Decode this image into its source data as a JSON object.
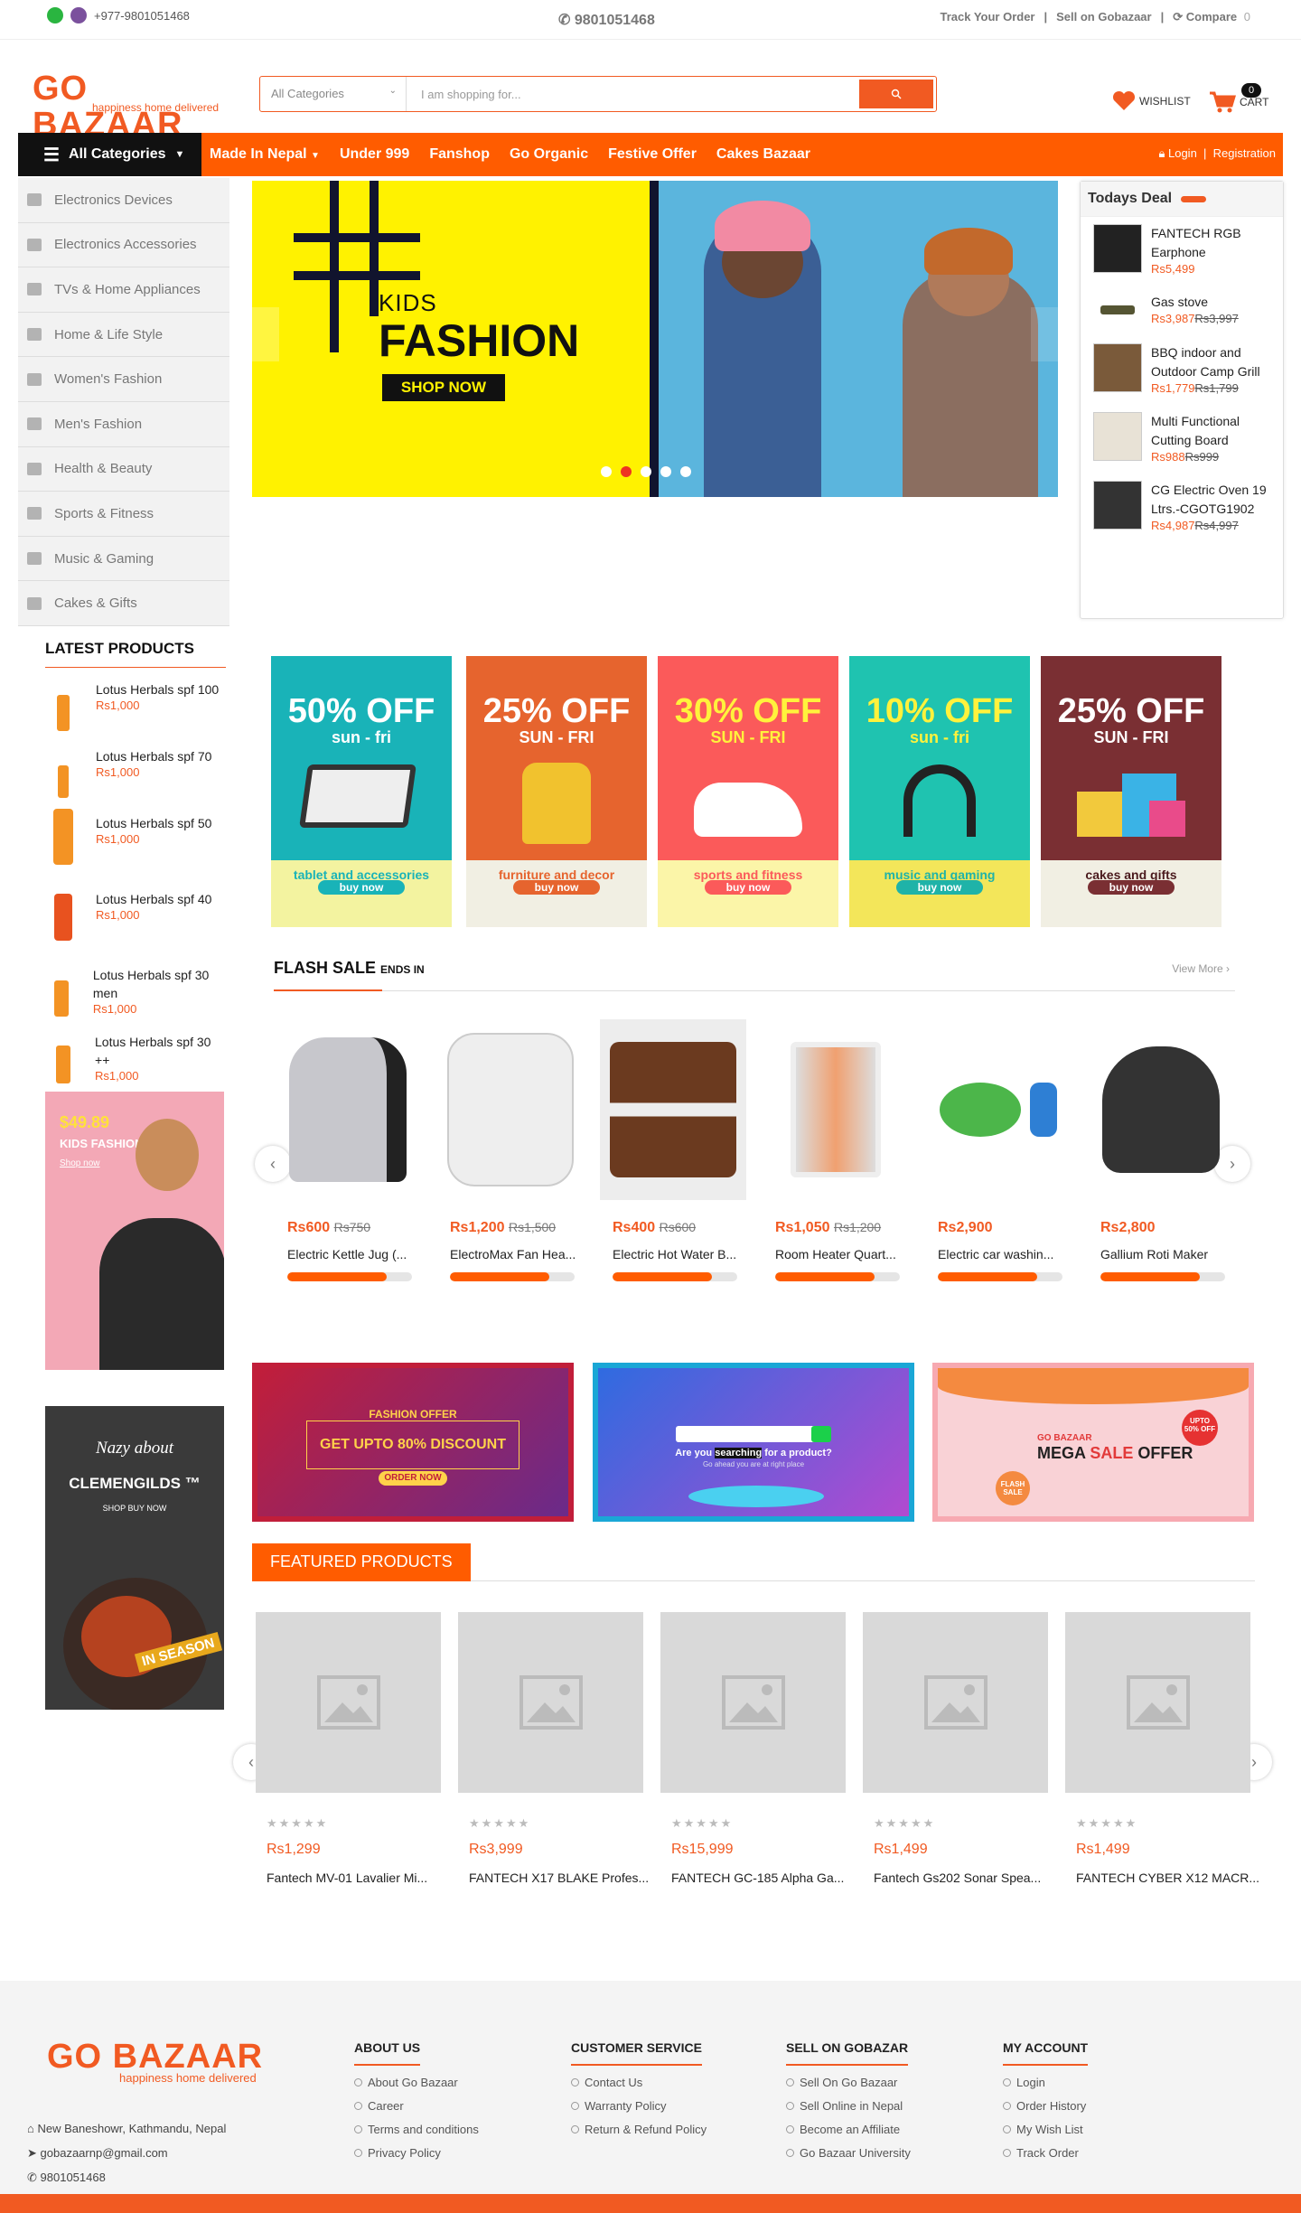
{
  "topbar": {
    "phone": "+977-9801051468",
    "center_phone": "9801051468",
    "track_order": "Track Your Order",
    "sell": "Sell on Gobazaar",
    "compare": "Compare",
    "compare_count": "0"
  },
  "header": {
    "logo_text": "GO BAZAAR",
    "logo_tagline": "happiness home delivered",
    "category_select": "All Categories",
    "search_placeholder": "I am shopping for...",
    "wishlist": "WISHLIST",
    "cart": "CART",
    "cart_count": "0"
  },
  "nav": {
    "all_categories": "All Categories",
    "items": [
      "Made In Nepal",
      "Under 999",
      "Fanshop",
      "Go Organic",
      "Festive Offer",
      "Cakes Bazaar"
    ],
    "login": "Login",
    "registration": "Registration"
  },
  "sidebar": [
    "Electronics Devices",
    "Electronics Accessories",
    "TVs & Home Appliances",
    "Home & Life Style",
    "Women's Fashion",
    "Men's Fashion",
    "Health & Beauty",
    "Sports & Fitness",
    "Music & Gaming",
    "Cakes & Gifts"
  ],
  "banner": {
    "line1": "KIDS",
    "line2": "FASHION",
    "cta": "SHOP NOW"
  },
  "todays_deal": {
    "title": "Todays Deal",
    "items": [
      {
        "name": "FANTECH RGB Earphone",
        "price": "Rs5,499",
        "old": ""
      },
      {
        "name": "Gas stove",
        "price": "Rs3,987",
        "old": "Rs3,997"
      },
      {
        "name": "BBQ indoor and Outdoor Camp Grill",
        "price": "Rs1,779",
        "old": "Rs1,799"
      },
      {
        "name": "Multi Functional Cutting Board",
        "price": "Rs988",
        "old": "Rs999"
      },
      {
        "name": "CG Electric Oven 19 Ltrs.-CGOTG1902",
        "price": "Rs4,987",
        "old": "Rs4,997"
      }
    ]
  },
  "latest": {
    "title": "LATEST PRODUCTS",
    "items": [
      {
        "name": "Lotus Herbals spf 100",
        "price": "Rs1,000"
      },
      {
        "name": "Lotus Herbals spf 70",
        "price": "Rs1,000"
      },
      {
        "name": "Lotus Herbals spf 50",
        "price": "Rs1,000"
      },
      {
        "name": "Lotus Herbals spf 40",
        "price": "Rs1,000"
      },
      {
        "name": "Lotus Herbals spf 30 men",
        "price": "Rs1,000"
      },
      {
        "name": "Lotus Herbals spf 30 ++",
        "price": "Rs1,000"
      }
    ]
  },
  "side_ads": {
    "kids_price": "$49.89",
    "kids_title": "KIDS FASHION",
    "kids_link": "Shop now",
    "clem_top": "Nazy about",
    "clem_title": "CLEMENGILDS ™",
    "clem_sub": "SHOP BUY NOW",
    "clem_season": "IN SEASON"
  },
  "promos": [
    {
      "pct": "50% OFF",
      "sub": "sun - fri",
      "label": "tablet and accessories",
      "buy": "buy now",
      "bg": "#19b3b8",
      "bottom": "#f3f3a0",
      "btn": "#19b3b8",
      "lc": "#19b3b8"
    },
    {
      "pct": "25% OFF",
      "sub": "SUN - FRI",
      "label": "furniture and decor",
      "buy": "buy now",
      "bg": "#e6642e",
      "bottom": "#f1efe3",
      "btn": "#e6642e",
      "lc": "#e6642e"
    },
    {
      "pct": "30% OFF",
      "sub": "SUN - FRI",
      "label": "sports and fitness",
      "buy": "buy now",
      "bg": "#fb5a5a",
      "bottom": "#fbf5a8",
      "btn": "#fb5a5a",
      "lc": "#fb5a5a"
    },
    {
      "pct": "10% OFF",
      "sub": "sun - fri",
      "label": "music and gaming",
      "buy": "buy now",
      "bg": "#1fc3b0",
      "bottom": "#f3e65a",
      "btn": "#1fb3a8",
      "lc": "#1fb3a8"
    },
    {
      "pct": "25% OFF",
      "sub": "SUN - FRI",
      "label": "cakes and gifts",
      "buy": "buy now",
      "bg": "#7a2f33",
      "bottom": "#f1efe3",
      "btn": "#7a2f33",
      "lc": "#4a1a1d"
    }
  ],
  "flash": {
    "title": "FLASH SALE",
    "ends": "ENDS IN",
    "more": "View More",
    "items": [
      {
        "price": "Rs600",
        "old": "Rs750",
        "name": "Electric Kettle Jug (...",
        "progress": 0.8
      },
      {
        "price": "Rs1,200",
        "old": "Rs1,500",
        "name": "ElectroMax Fan Hea...",
        "progress": 0.8
      },
      {
        "price": "Rs400",
        "old": "Rs600",
        "name": "Electric Hot Water B...",
        "progress": 0.8
      },
      {
        "price": "Rs1,050",
        "old": "Rs1,200",
        "name": "Room Heater Quart...",
        "progress": 0.8
      },
      {
        "price": "Rs2,900",
        "old": "",
        "name": "Electric car washin...",
        "progress": 0.8
      },
      {
        "price": "Rs2,800",
        "old": "",
        "name": "Gallium Roti Maker",
        "progress": 0.8
      }
    ]
  },
  "ads": {
    "a1_title": "FASHION OFFER",
    "a1_pct": "GET UPTO 80% DISCOUNT",
    "a1_btn": "ORDER NOW",
    "a2_q1": "Are you",
    "a2_q2": "searching",
    "a2_q3": "for a product?",
    "a2_sub": "Go ahead you are at right place",
    "a3_brand": "GO BAZAAR",
    "a3_t1": "MEGA",
    "a3_t2": "SALE",
    "a3_t3": "OFFER",
    "a3_upto": "UPTO 50% OFF",
    "a3_flash": "FLASH SALE"
  },
  "featured": {
    "title": "FEATURED PRODUCTS",
    "stars": "★★★★★",
    "items": [
      {
        "price": "Rs1,299",
        "name": "Fantech MV-01 Lavalier Mi..."
      },
      {
        "price": "Rs3,999",
        "name": "FANTECH X17 BLAKE Profes..."
      },
      {
        "price": "Rs15,999",
        "name": "FANTECH GC-185 Alpha Ga..."
      },
      {
        "price": "Rs1,499",
        "name": "Fantech Gs202 Sonar Spea..."
      },
      {
        "price": "Rs1,499",
        "name": "FANTECH CYBER X12 MACR..."
      }
    ]
  },
  "footer": {
    "address": "New Baneshowr, Kathmandu, Nepal",
    "email": "gobazaarnp@gmail.com",
    "phone": "9801051468",
    "about": {
      "title": "ABOUT US",
      "links": [
        "About Go Bazaar",
        "Career",
        "Terms and conditions",
        "Privacy Policy"
      ]
    },
    "service": {
      "title": "CUSTOMER SERVICE",
      "links": [
        "Contact Us",
        "Warranty Policy",
        "Return & Refund Policy"
      ]
    },
    "sell": {
      "title": "SELL ON GOBAZAR",
      "links": [
        "Sell On Go Bazaar",
        "Sell Online in Nepal",
        "Become an Affiliate",
        "Go Bazaar University"
      ]
    },
    "account": {
      "title": "MY ACCOUNT",
      "links": [
        "Login",
        "Order History",
        "My Wish List",
        "Track Order"
      ]
    }
  }
}
